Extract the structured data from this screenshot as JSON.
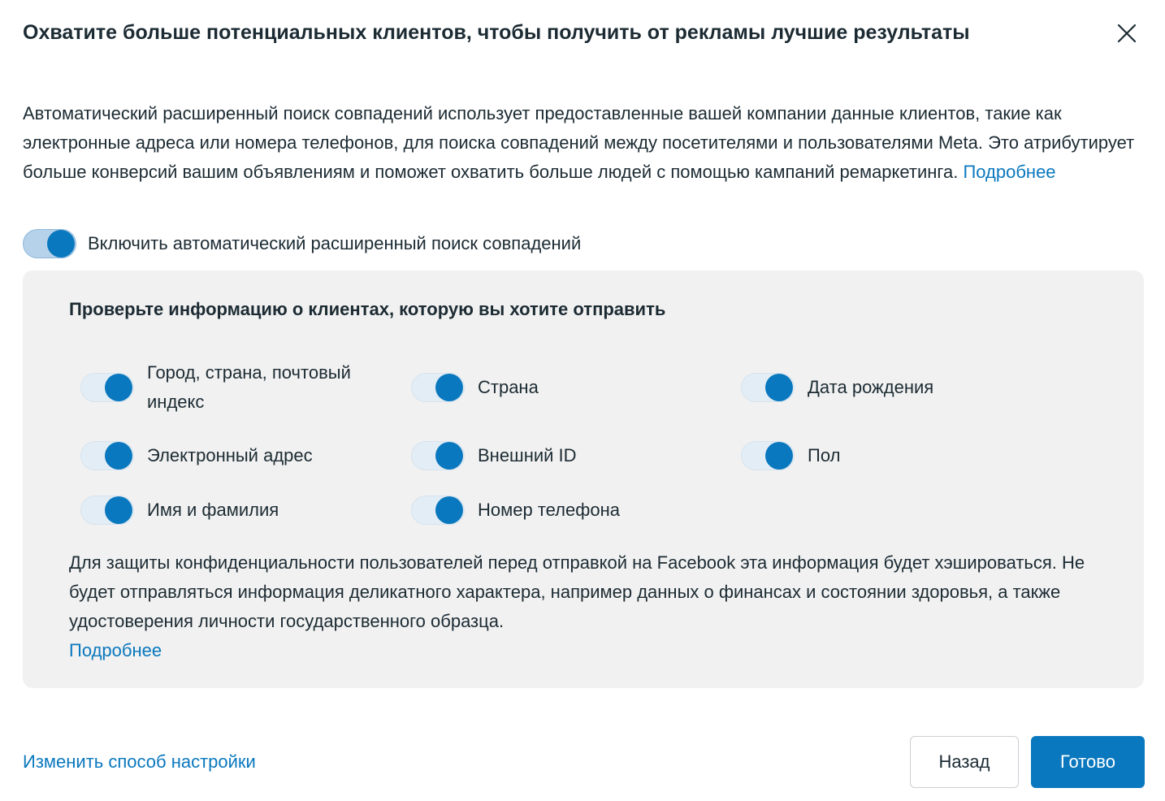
{
  "dialog": {
    "title": "Охватите больше потенциальных клиентов, чтобы получить от рекламы лучшие результаты",
    "close_icon": "close-icon",
    "description": "Автоматический расширенный поиск совпадений использует предоставленные вашей компании данные клиентов, такие как электронные адреса или номера телефонов, для поиска совпадений между посетителями и пользователями Meta. Это атрибутирует больше конверсий вашим объявлениям и поможет охватить больше людей с помощью кампаний ремаркетинга.",
    "description_link": "Подробнее"
  },
  "master_toggle": {
    "label": "Включить автоматический расширенный поиск совпадений",
    "checked": true
  },
  "panel": {
    "title": "Проверьте информацию о клиентах, которую вы хотите отправить",
    "fields": [
      {
        "label": "Город, страна, почтовый индекс",
        "checked": true
      },
      {
        "label": "Страна",
        "checked": true
      },
      {
        "label": "Дата рождения",
        "checked": true
      },
      {
        "label": "Электронный адрес",
        "checked": true
      },
      {
        "label": "Внешний ID",
        "checked": true
      },
      {
        "label": "Пол",
        "checked": true
      },
      {
        "label": "Имя и фамилия",
        "checked": true
      },
      {
        "label": "Номер телефона",
        "checked": true
      }
    ],
    "privacy_text": "Для защиты конфиденциальности пользователей перед отправкой на Facebook эта информация будет хэшироваться. Не будет отправляться информация деликатного характера, например данных о финансах и состоянии здоровья, а также удостоверения личности государственного образца.",
    "privacy_link": "Подробнее"
  },
  "footer": {
    "change_setup_link": "Изменить способ настройки",
    "back_label": "Назад",
    "done_label": "Готово"
  },
  "colors": {
    "accent": "#0a78be",
    "text": "#1c2b33",
    "panel_bg": "#f1f1f1"
  }
}
